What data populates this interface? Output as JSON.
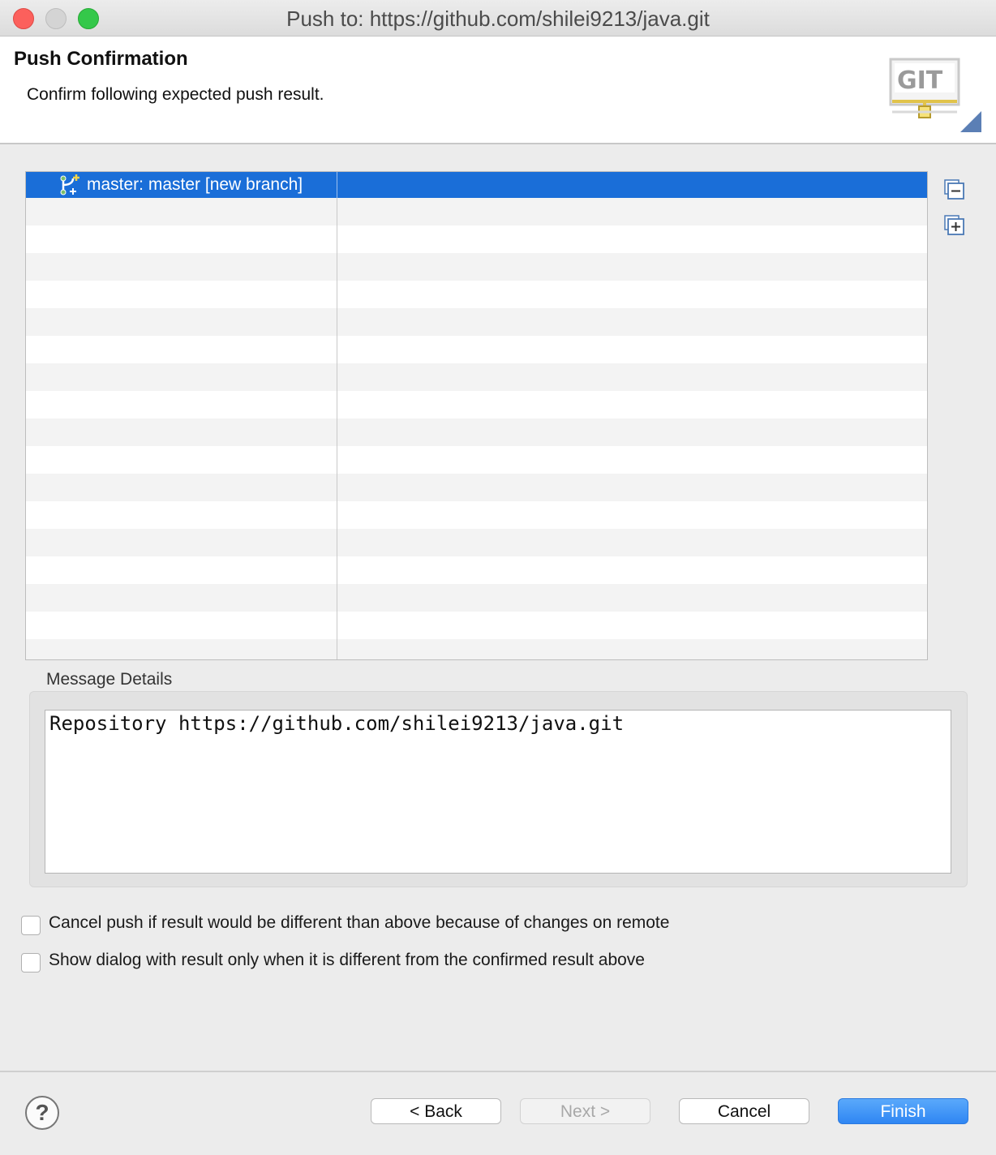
{
  "window": {
    "title": "Push to: https://github.com/shilei9213/java.git"
  },
  "header": {
    "title": "Push Confirmation",
    "description": "Confirm following expected push result.",
    "logo_text": "GIT"
  },
  "table": {
    "rows": [
      {
        "label": "master: master [new branch]",
        "icon": "new-branch-icon",
        "selected": true
      }
    ],
    "selection_color": "#1a6ed8"
  },
  "tools": {
    "collapse_all": "collapse-all-icon",
    "expand_all": "expand-all-icon"
  },
  "message_details": {
    "label": "Message Details",
    "text": "Repository https://github.com/shilei9213/java.git"
  },
  "options": {
    "cancel_if_different": {
      "label": "Cancel push if result would be different than above because of changes on remote",
      "checked": false
    },
    "show_dialog_if_different": {
      "label": "Show dialog with result only when it is different from the confirmed result above",
      "checked": false
    }
  },
  "footer": {
    "help": "?",
    "back": "< Back",
    "next": "Next >",
    "cancel": "Cancel",
    "finish": "Finish"
  }
}
